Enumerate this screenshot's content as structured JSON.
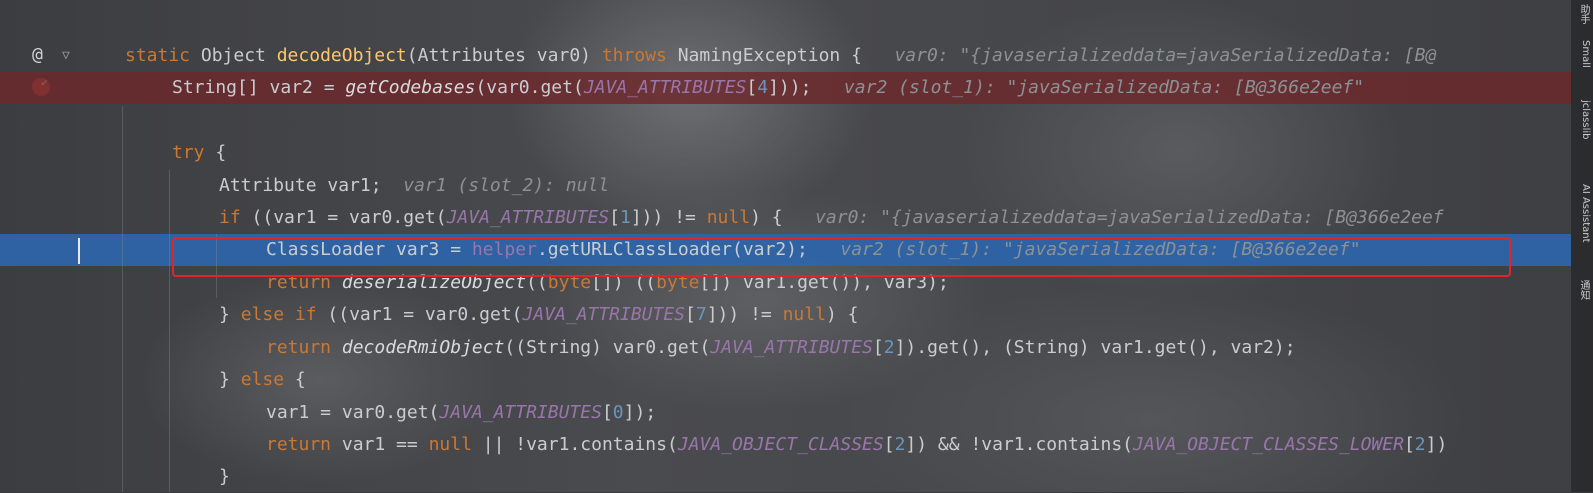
{
  "editor": {
    "lines": [
      [
        [
          "static ",
          "kw"
        ],
        [
          "Object ",
          ""
        ],
        [
          "decodeObject",
          "fn"
        ],
        [
          "(Attributes var0) ",
          ""
        ],
        [
          "throws ",
          "kw"
        ],
        [
          "NamingException {",
          ""
        ],
        [
          "   var0: \"{javaserializeddata=javaSerializedData: [B@",
          "hint"
        ]
      ],
      [
        [
          "String[] var2 = ",
          ""
        ],
        [
          "getCodebases",
          "call"
        ],
        [
          "(var0.get(",
          ""
        ],
        [
          "JAVA_ATTRIBUTES",
          "const"
        ],
        [
          "[",
          ""
        ],
        [
          "4",
          "num"
        ],
        [
          "]));",
          ""
        ],
        [
          "   var2 (slot_1): \"javaSerializedData: [B@366e2eef\"",
          "hint"
        ]
      ],
      [],
      [
        [
          "try ",
          "kw"
        ],
        [
          "{",
          ""
        ]
      ],
      [
        [
          "Attribute var1;",
          ""
        ],
        [
          "  var1 (slot_2): null",
          "hint"
        ]
      ],
      [
        [
          "if ",
          "kw"
        ],
        [
          "((var1 = var0.get(",
          ""
        ],
        [
          "JAVA_ATTRIBUTES",
          "const"
        ],
        [
          "[",
          ""
        ],
        [
          "1",
          "num"
        ],
        [
          "])) != ",
          ""
        ],
        [
          "null",
          "kw"
        ],
        [
          ") {",
          ""
        ],
        [
          "   var0: \"{javaserializeddata=javaSerializedData: [B@366e2eef",
          "hint"
        ]
      ],
      [
        [
          "ClassLoader var3 = ",
          ""
        ],
        [
          "helper",
          "field"
        ],
        [
          ".getURLClassLoader(var2);",
          ""
        ],
        [
          "   var2 (slot_1): \"javaSerializedData: [B@366e2eef\"",
          "hint"
        ]
      ],
      [
        [
          "return ",
          "kw"
        ],
        [
          "deserializeObject",
          "call"
        ],
        [
          "((",
          ""
        ],
        [
          "byte",
          "kw"
        ],
        [
          "[]) ((",
          ""
        ],
        [
          "byte",
          "kw"
        ],
        [
          "[]) var1.get()), var3);",
          ""
        ]
      ],
      [
        [
          "} ",
          ""
        ],
        [
          "else if ",
          "kw"
        ],
        [
          "((var1 = var0.get(",
          ""
        ],
        [
          "JAVA_ATTRIBUTES",
          "const"
        ],
        [
          "[",
          ""
        ],
        [
          "7",
          "num"
        ],
        [
          "])) != ",
          ""
        ],
        [
          "null",
          "kw"
        ],
        [
          ") {",
          ""
        ]
      ],
      [
        [
          "return ",
          "kw"
        ],
        [
          "decodeRmiObject",
          "call"
        ],
        [
          "((String) var0.get(",
          ""
        ],
        [
          "JAVA_ATTRIBUTES",
          "const"
        ],
        [
          "[",
          ""
        ],
        [
          "2",
          "num"
        ],
        [
          "]).get(), (String) var1.get(), var2);",
          ""
        ]
      ],
      [
        [
          "} ",
          ""
        ],
        [
          "else ",
          "kw"
        ],
        [
          "{",
          ""
        ]
      ],
      [
        [
          "var1 = var0.get(",
          ""
        ],
        [
          "JAVA_ATTRIBUTES",
          "const"
        ],
        [
          "[",
          ""
        ],
        [
          "0",
          "num"
        ],
        [
          "]);",
          ""
        ]
      ],
      [
        [
          "return ",
          "kw"
        ],
        [
          "var1 == ",
          ""
        ],
        [
          "null ",
          "kw"
        ],
        [
          "|| !var1.contains(",
          ""
        ],
        [
          "JAVA_OBJECT_CLASSES",
          "const"
        ],
        [
          "[",
          ""
        ],
        [
          "2",
          "num"
        ],
        [
          "]) && !var1.contains(",
          ""
        ],
        [
          "JAVA_OBJECT_CLASSES_LOWER",
          "const"
        ],
        [
          "[",
          ""
        ],
        [
          "2",
          "num"
        ],
        [
          "])",
          ""
        ]
      ],
      [
        [
          "}",
          ""
        ]
      ]
    ]
  },
  "gutter": {
    "at_symbol": "@",
    "breakpoint_check": "✔"
  },
  "right_sidebar": {
    "items": [
      "助手",
      "Small",
      "jclasslib",
      "AI Assistant",
      "通知"
    ]
  },
  "colors": {
    "keyword": "#cc7832",
    "method_decl": "#ffc66d",
    "constant": "#9876aa",
    "number": "#6897bb",
    "breakpoint_line": "#6e282c",
    "current_line": "#2e65aa",
    "annotation_box": "#e0252a"
  }
}
